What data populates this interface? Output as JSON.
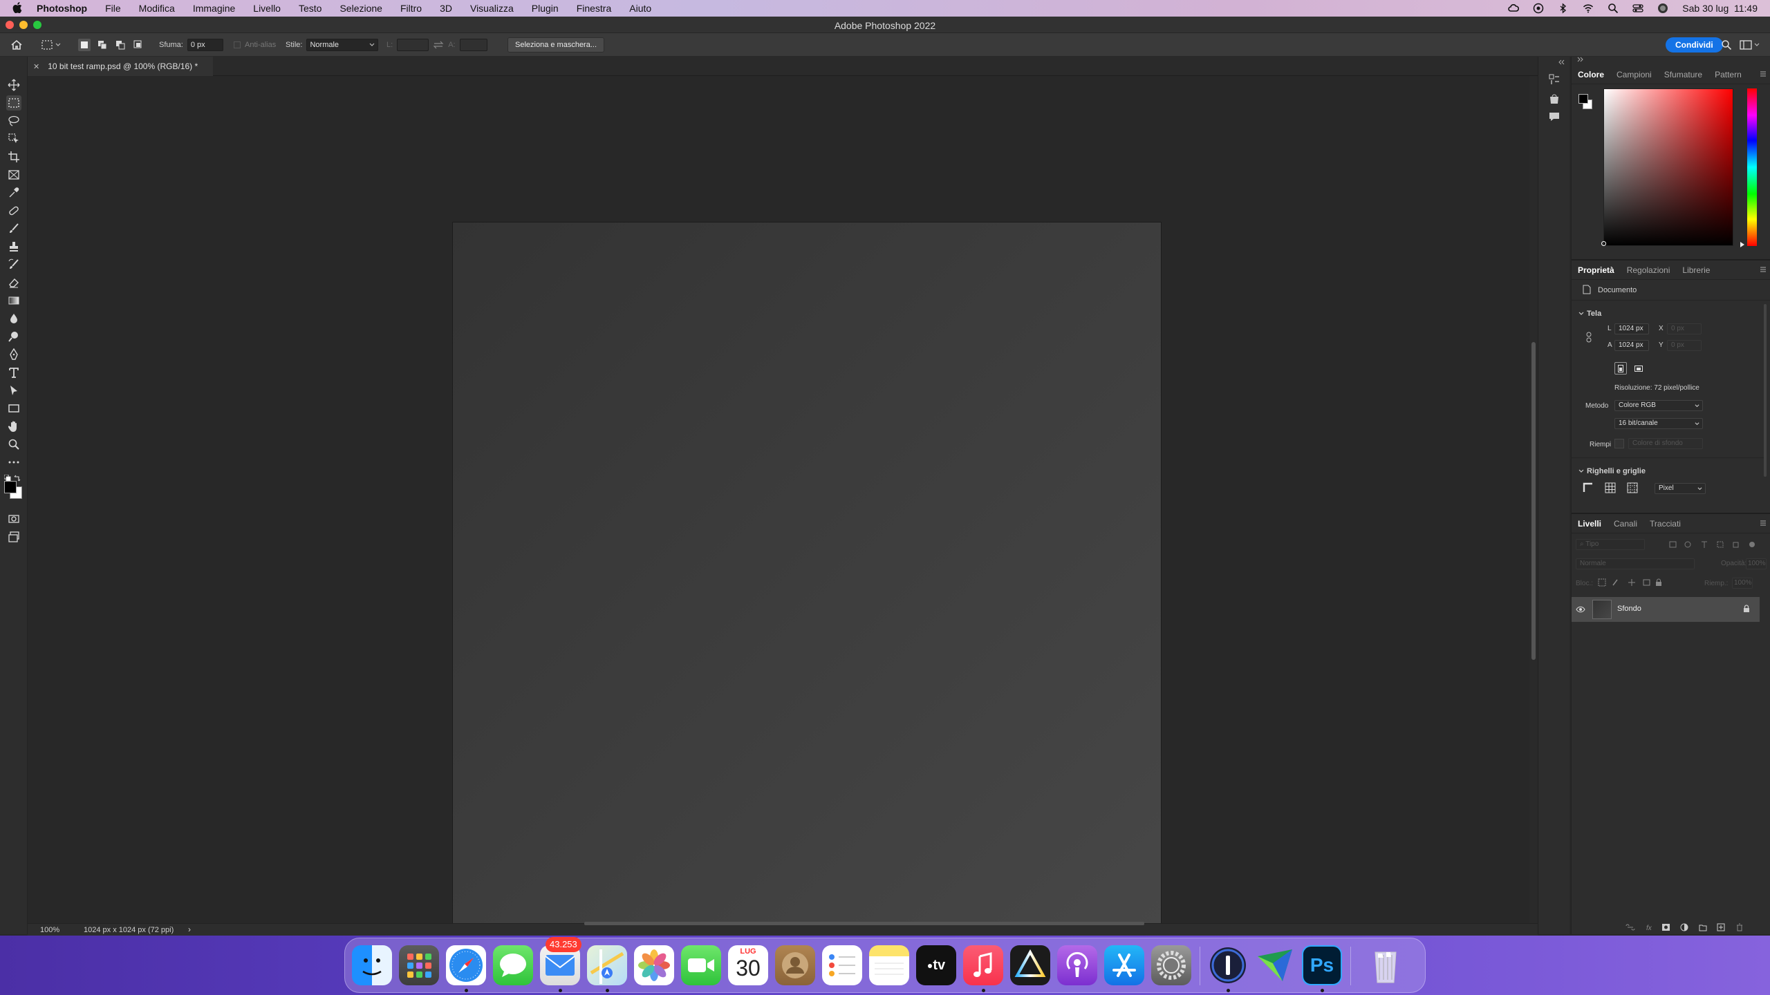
{
  "menubar": {
    "app_name": "Photoshop",
    "menus": [
      "File",
      "Modifica",
      "Immagine",
      "Livello",
      "Testo",
      "Selezione",
      "Filtro",
      "3D",
      "Visualizza",
      "Plugin",
      "Finestra",
      "Aiuto"
    ],
    "clock": "Sab 30 lug  11:49"
  },
  "window": {
    "title": "Adobe Photoshop 2022"
  },
  "options": {
    "feather_label": "Sfuma:",
    "feather_value": "0 px",
    "antialias_label": "Anti-alias",
    "style_label": "Stile:",
    "style_value": "Normale",
    "width_label": "L:",
    "height_label": "A:",
    "select_mask_button": "Seleziona e maschera...",
    "share_button": "Condividi"
  },
  "document": {
    "tab_title": "10 bit test ramp.psd @ 100% (RGB/16) *",
    "zoom": "100%",
    "info": "1024 px x 1024 px (72 ppi)"
  },
  "color_panel": {
    "tabs": [
      "Colore",
      "Campioni",
      "Sfumature",
      "Pattern"
    ],
    "active_tab": "Colore"
  },
  "properties_panel": {
    "tabs": [
      "Proprietà",
      "Regolazioni",
      "Librerie"
    ],
    "active_tab": "Proprietà",
    "doc_label": "Documento",
    "canvas_section": "Tela",
    "width_label": "L",
    "width_value": "1024 px",
    "height_label": "A",
    "height_value": "1024 px",
    "x_label": "X",
    "x_value": "0 px",
    "y_label": "Y",
    "y_value": "0 px",
    "resolution": "Risoluzione: 72 pixel/pollice",
    "mode_label": "Metodo",
    "mode_value": "Colore RGB",
    "depth_value": "16 bit/canale",
    "fill_label": "Riempi",
    "fill_value": "Colore di sfondo",
    "rulers_section": "Righelli e griglie",
    "units_value": "Pixel"
  },
  "layers_panel": {
    "tabs": [
      "Livelli",
      "Canali",
      "Tracciati"
    ],
    "active_tab": "Livelli",
    "search_placeholder": "Tipo",
    "blend_mode": "Normale",
    "opacity_label": "Opacità:",
    "opacity_value": "100%",
    "lock_label": "Bloc.:",
    "fill_label": "Riemp.:",
    "fill_value": "100%",
    "layers": [
      {
        "name": "Sfondo"
      }
    ]
  },
  "dock": {
    "mail_badge": "43.253",
    "calendar_month": "LUG",
    "calendar_day": "30",
    "tv_label": "tv",
    "ps_label": "Ps"
  },
  "colors": {
    "accent": "#1473e6",
    "canvas_dark": "#333333",
    "canvas_light": "#474747",
    "workspace": "#282828"
  }
}
